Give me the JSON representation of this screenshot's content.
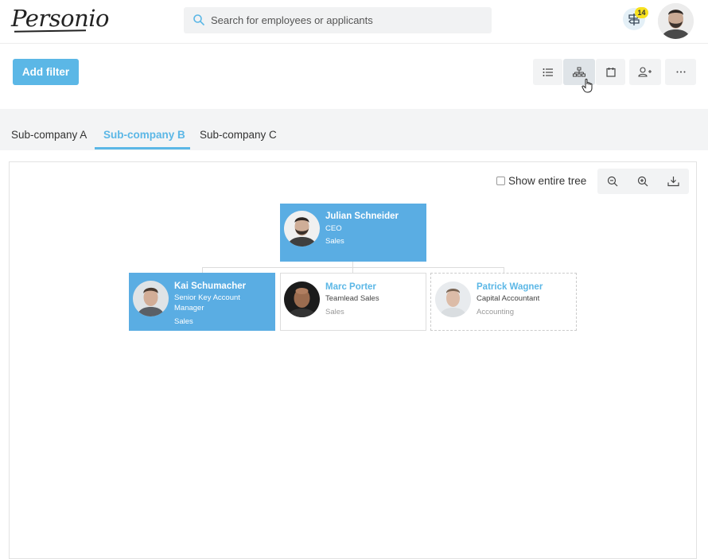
{
  "app": {
    "logo_text": "Personio"
  },
  "search": {
    "placeholder": "Search for employees or applicants"
  },
  "notifications": {
    "count": "14"
  },
  "actions": {
    "add_filter_label": "Add filter"
  },
  "tabs": [
    {
      "label": "Sub-company A"
    },
    {
      "label": "Sub-company B",
      "active": true
    },
    {
      "label": "Sub-company C"
    }
  ],
  "tree_controls": {
    "show_entire_tree_label": "Show entire tree",
    "show_entire_tree_checked": false
  },
  "org": {
    "root": {
      "name": "Julian Schneider",
      "role": "CEO",
      "department": "Sales"
    },
    "children": [
      {
        "name": "Kai Schumacher",
        "role": "Senior Key Account Manager",
        "department": "Sales"
      },
      {
        "name": "Marc Porter",
        "role": "Teamlead Sales",
        "department": "Sales"
      },
      {
        "name": "Patrick Wagner",
        "role": "Capital Accountant",
        "department": "Accounting"
      }
    ]
  },
  "colors": {
    "accent": "#5bb7e6",
    "card_blue": "#5aade3",
    "badge": "#f7e11f"
  },
  "icons": [
    "search-icon",
    "signpost-icon",
    "list-view-icon",
    "org-chart-icon",
    "calendar-icon",
    "add-person-icon",
    "more-icon",
    "zoom-out-icon",
    "zoom-in-icon",
    "download-icon",
    "hand-cursor-icon"
  ]
}
